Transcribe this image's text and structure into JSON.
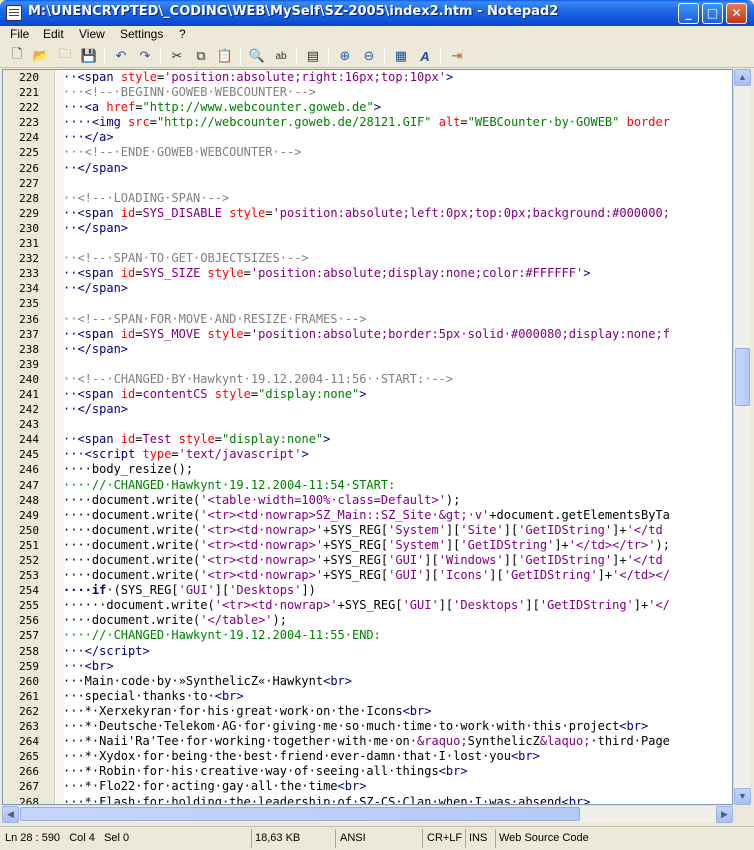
{
  "window": {
    "title": "M:\\UNENCRYPTED\\_CODING\\WEB\\MySelf\\SZ-2005\\index2.htm - Notepad2",
    "minimize_icon": "minimize-icon",
    "maximize_icon": "maximize-icon",
    "close_icon": "close-icon"
  },
  "menu": {
    "file": "File",
    "edit": "Edit",
    "view": "View",
    "settings": "Settings",
    "help": "?"
  },
  "toolbar": {
    "icons": [
      "new-file-icon",
      "open-folder-icon",
      "browse-icon",
      "save-icon",
      "undo-icon",
      "redo-icon",
      "cut-icon",
      "copy-icon",
      "paste-icon",
      "find-icon",
      "replace-icon",
      "word-wrap-icon",
      "zoom-in-icon",
      "zoom-out-icon",
      "scheme-icon",
      "font-icon",
      "exit-icon"
    ]
  },
  "editor": {
    "lines": [
      {
        "n": "220",
        "html": "<span class='t-tag'>··&lt;span</span> <span class='t-attr'>style</span>=<span class='t-val'>'position:absolute;right:16px;top:10px'</span><span class='t-tag'>&gt;</span>"
      },
      {
        "n": "221",
        "html": "<span class='t-com'>···&lt;!--·BEGINN·GOWEB·WEBCOUNTER·--&gt;</span>"
      },
      {
        "n": "222",
        "html": "<span class='t-tag'>···&lt;a</span> <span class='t-attr'>href</span>=<span class='t-str'>\"http://www.webcounter.goweb.de\"</span><span class='t-tag'>&gt;</span>"
      },
      {
        "n": "223",
        "html": "<span class='t-tag'>····&lt;img</span> <span class='t-attr'>src</span>=<span class='t-str'>\"http://webcounter.goweb.de/28121.GIF\"</span> <span class='t-attr'>alt</span>=<span class='t-str'>\"WEBCounter·by·GOWEB\"</span> <span class='t-attr'>border</span>"
      },
      {
        "n": "224",
        "html": "<span class='t-tag'>···&lt;/a&gt;</span>"
      },
      {
        "n": "225",
        "html": "<span class='t-com'>···&lt;!--·ENDE·GOWEB·WEBCOUNTER·--&gt;</span>"
      },
      {
        "n": "226",
        "html": "<span class='t-tag'>··&lt;/span&gt;</span>"
      },
      {
        "n": "227",
        "html": ""
      },
      {
        "n": "228",
        "html": "<span class='t-com'>··&lt;!--·LOADING·SPAN·--&gt;</span>"
      },
      {
        "n": "229",
        "html": "<span class='t-tag'>··&lt;span</span> <span class='t-attr'>id</span>=<span class='t-val'>SYS_DISABLE</span> <span class='t-attr'>style</span>=<span class='t-val'>'position:absolute;left:0px;top:0px;background:#000000;</span>"
      },
      {
        "n": "230",
        "html": "<span class='t-tag'>··&lt;/span&gt;</span>"
      },
      {
        "n": "231",
        "html": ""
      },
      {
        "n": "232",
        "html": "<span class='t-com'>··&lt;!--·SPAN·TO·GET·OBJECTSIZES·--&gt;</span>"
      },
      {
        "n": "233",
        "html": "<span class='t-tag'>··&lt;span</span> <span class='t-attr'>id</span>=<span class='t-val'>SYS_SIZE</span> <span class='t-attr'>style</span>=<span class='t-val'>'position:absolute;display:none;color:#FFFFFF'</span><span class='t-tag'>&gt;</span>"
      },
      {
        "n": "234",
        "html": "<span class='t-tag'>··&lt;/span&gt;</span>"
      },
      {
        "n": "235",
        "html": ""
      },
      {
        "n": "236",
        "html": "<span class='t-com'>··&lt;!--·SPAN·FOR·MOVE·AND·RESIZE·FRAMES·--&gt;</span>"
      },
      {
        "n": "237",
        "html": "<span class='t-tag'>··&lt;span</span> <span class='t-attr'>id</span>=<span class='t-val'>SYS_MOVE</span> <span class='t-attr'>style</span>=<span class='t-val'>'position:absolute;border:5px·solid·#000080;display:none;f</span>"
      },
      {
        "n": "238",
        "html": "<span class='t-tag'>··&lt;/span&gt;</span>"
      },
      {
        "n": "239",
        "html": ""
      },
      {
        "n": "240",
        "html": "<span class='t-com'>··&lt;!--·CHANGED·BY·Hawkynt·19.12.2004-11:56··START:·--&gt;</span>"
      },
      {
        "n": "241",
        "html": "<span class='t-tag'>··&lt;span</span> <span class='t-attr'>id</span>=<span class='t-val'>contentCS</span> <span class='t-attr'>style</span>=<span class='t-str'>\"display:none\"</span><span class='t-tag'>&gt;</span>"
      },
      {
        "n": "242",
        "html": "<span class='t-tag'>··&lt;/span&gt;</span>"
      },
      {
        "n": "243",
        "html": ""
      },
      {
        "n": "244",
        "html": "<span class='t-tag'>··&lt;span</span> <span class='t-attr'>id</span>=<span class='t-val'>Test</span> <span class='t-attr'>style</span>=<span class='t-str'>\"display:none\"</span><span class='t-tag'>&gt;</span>"
      },
      {
        "n": "245",
        "html": "<span class='t-tag'>···&lt;script</span> <span class='t-attr'>type</span>=<span class='t-val'>'text/javascript'</span><span class='t-tag'>&gt;</span>"
      },
      {
        "n": "246",
        "html": "<span class='t-js'>····body_resize();</span>"
      },
      {
        "n": "247",
        "html": "<span class='t-jscom'>····//·CHANGED·Hawkynt·19.12.2004-11:54·START:</span>"
      },
      {
        "n": "248",
        "html": "<span class='t-js'>····document.write(</span><span class='t-val'>'&lt;table·width=100%·class=Default&gt;'</span><span class='t-js'>);</span>"
      },
      {
        "n": "249",
        "html": "<span class='t-js'>····document.write(</span><span class='t-val'>'&lt;tr&gt;&lt;td·nowrap&gt;SZ_Main::SZ_Site·&amp;gt;·v'</span><span class='t-js'>+document.getElementsByTa</span>"
      },
      {
        "n": "250",
        "html": "<span class='t-js'>····document.write(</span><span class='t-val'>'&lt;tr&gt;&lt;td·nowrap&gt;'</span><span class='t-js'>+SYS_REG[</span><span class='t-val'>'System'</span><span class='t-js'>][</span><span class='t-val'>'Site'</span><span class='t-js'>][</span><span class='t-val'>'GetIDString'</span><span class='t-js'>]+</span><span class='t-val'>'&lt;/td</span>"
      },
      {
        "n": "251",
        "html": "<span class='t-js'>····document.write(</span><span class='t-val'>'&lt;tr&gt;&lt;td·nowrap&gt;'</span><span class='t-js'>+SYS_REG[</span><span class='t-val'>'System'</span><span class='t-js'>][</span><span class='t-val'>'GetIDString'</span><span class='t-js'>]+</span><span class='t-val'>'&lt;/td&gt;&lt;/tr&gt;'</span><span class='t-js'>);</span>"
      },
      {
        "n": "252",
        "html": "<span class='t-js'>····document.write(</span><span class='t-val'>'&lt;tr&gt;&lt;td·nowrap&gt;'</span><span class='t-js'>+SYS_REG[</span><span class='t-val'>'GUI'</span><span class='t-js'>][</span><span class='t-val'>'Windows'</span><span class='t-js'>][</span><span class='t-val'>'GetIDString'</span><span class='t-js'>]+</span><span class='t-val'>'&lt;/td</span>"
      },
      {
        "n": "253",
        "html": "<span class='t-js'>····document.write(</span><span class='t-val'>'&lt;tr&gt;&lt;td·nowrap&gt;'</span><span class='t-js'>+SYS_REG[</span><span class='t-val'>'GUI'</span><span class='t-js'>][</span><span class='t-val'>'Icons'</span><span class='t-js'>][</span><span class='t-val'>'GetIDString'</span><span class='t-js'>]+</span><span class='t-val'>'&lt;/td&gt;&lt;/</span>"
      },
      {
        "n": "254",
        "html": "<span class='t-kw'>····if</span><span class='t-js'>·(SYS_REG[</span><span class='t-val'>'GUI'</span><span class='t-js'>][</span><span class='t-val'>'Desktops'</span><span class='t-js'>])</span>"
      },
      {
        "n": "255",
        "html": "<span class='t-js'>······document.write(</span><span class='t-val'>'&lt;tr&gt;&lt;td·nowrap&gt;'</span><span class='t-js'>+SYS_REG[</span><span class='t-val'>'GUI'</span><span class='t-js'>][</span><span class='t-val'>'Desktops'</span><span class='t-js'>][</span><span class='t-val'>'GetIDString'</span><span class='t-js'>]+</span><span class='t-val'>'&lt;/</span>"
      },
      {
        "n": "256",
        "html": "<span class='t-js'>····document.write(</span><span class='t-val'>'&lt;/table&gt;'</span><span class='t-js'>);</span>"
      },
      {
        "n": "257",
        "html": "<span class='t-jscom'>····//·CHANGED·Hawkynt·19.12.2004-11:55·END:</span>"
      },
      {
        "n": "258",
        "html": "<span class='t-tag'>···&lt;/script&gt;</span>"
      },
      {
        "n": "259",
        "html": "<span class='t-tag'>···&lt;br&gt;</span>"
      },
      {
        "n": "260",
        "html": "<span class='t-js'>···Main·code·by·»SynthelicZ«·Hawkynt</span><span class='t-tag'>&lt;br&gt;</span>"
      },
      {
        "n": "261",
        "html": "<span class='t-js'>···special·thanks·to·</span><span class='t-tag'>&lt;br&gt;</span>"
      },
      {
        "n": "262",
        "html": "<span class='t-js'>···*·Xerxekyran·for·his·great·work·on·the·Icons</span><span class='t-tag'>&lt;br&gt;</span>"
      },
      {
        "n": "263",
        "html": "<span class='t-js'>···*·Deutsche·Telekom·AG·for·giving·me·so·much·time·to·work·with·this·project</span><span class='t-tag'>&lt;br&gt;</span>"
      },
      {
        "n": "264",
        "html": "<span class='t-js'>···*·Naii'Ra'Tee·for·working·together·with·me·on·</span><span class='t-val'>&amp;raquo;</span><span class='t-js'>SynthelicZ</span><span class='t-val'>&amp;laquo;</span><span class='t-js'>·third·Page</span>"
      },
      {
        "n": "265",
        "html": "<span class='t-js'>···*·Xydox·for·being·the·best·friend·ever-damn·that·I·lost·you</span><span class='t-tag'>&lt;br&gt;</span>"
      },
      {
        "n": "266",
        "html": "<span class='t-js'>···*·Robin·for·his·creative·way·of·seeing·all·things</span><span class='t-tag'>&lt;br&gt;</span>"
      },
      {
        "n": "267",
        "html": "<span class='t-js'>···*·Flo22·for·acting·gay·all·the·time</span><span class='t-tag'>&lt;br&gt;</span>"
      },
      {
        "n": "268",
        "html": "<span class='t-js'>···*·Flash·for·holding·the·leadership·of·SZ-CS·Clan·when·I·was·absend</span><span class='t-tag'>&lt;br&gt;</span>"
      }
    ]
  },
  "statusbar": {
    "position": "Ln 28 : 590",
    "col": "Col 4",
    "sel": "Sel 0",
    "size": "18,63 KB",
    "encoding": "ANSI",
    "eol": "CR+LF",
    "ins": "INS",
    "scheme": "Web Source Code"
  }
}
